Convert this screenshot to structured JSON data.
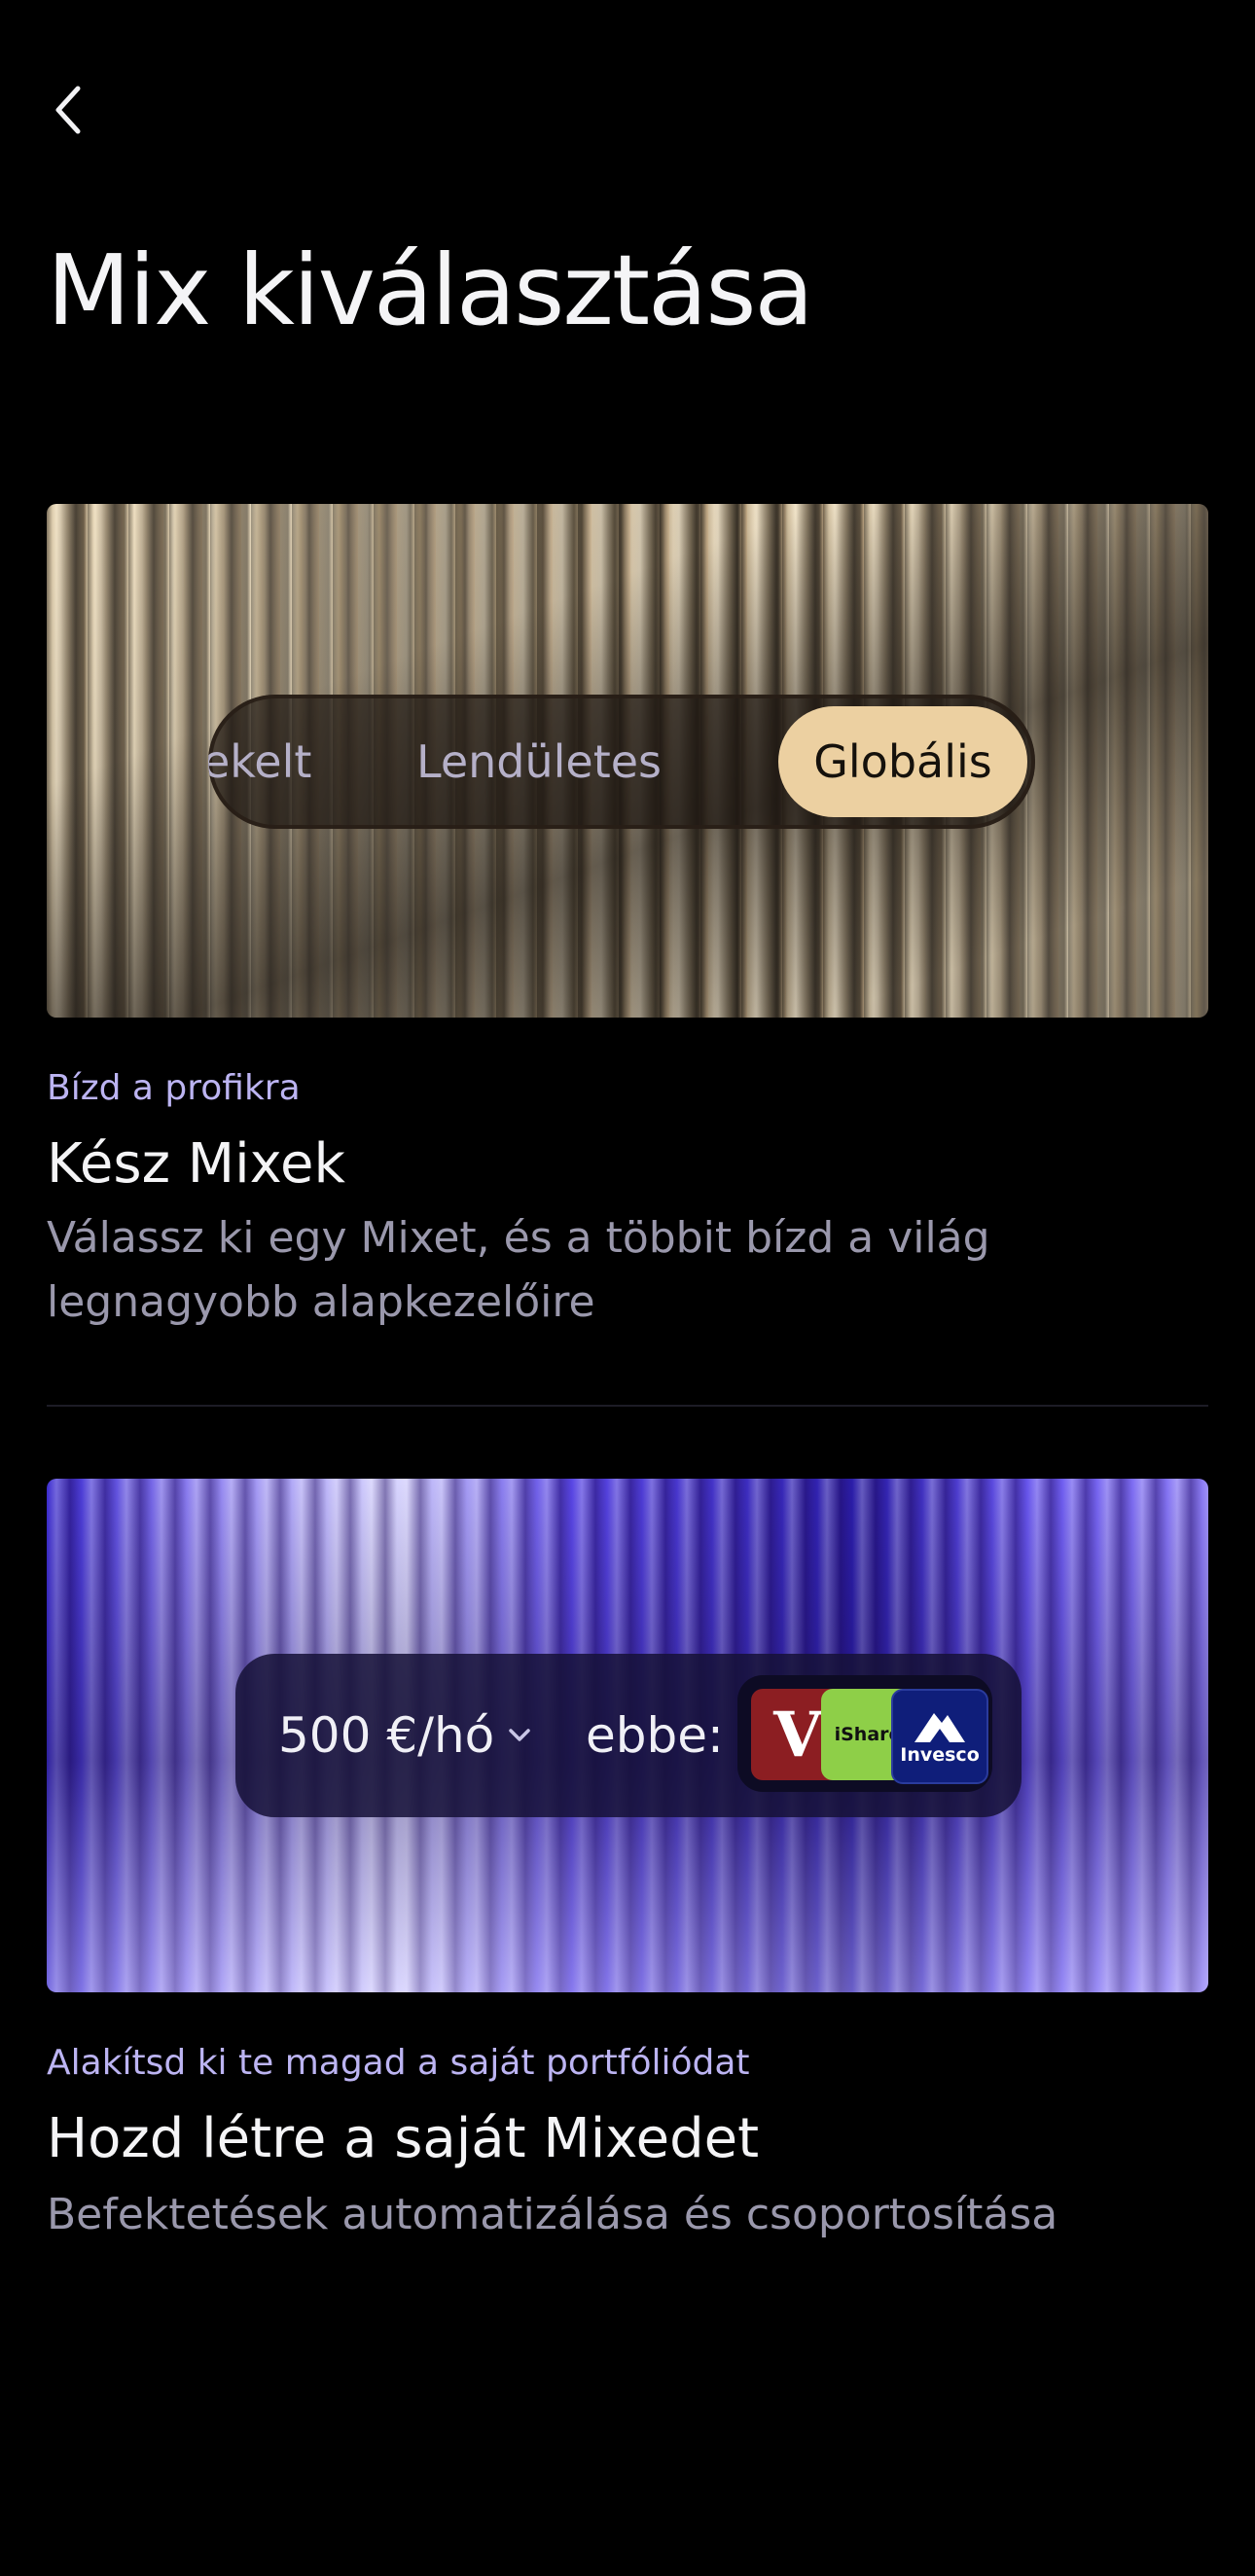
{
  "header": {
    "back_label": "Back",
    "title": "Mix kiválasztása"
  },
  "ready_mix": {
    "segments": [
      "ekelt",
      "Lendületes",
      "Globális"
    ],
    "active_segment": "Globális",
    "eyebrow": "Bízd a profikra",
    "heading": "Kész Mixek",
    "description": "Válassz ki egy Mixet, és a többit bízd a világ legnagyobb alapkezelőire"
  },
  "custom_mix": {
    "amount": "500 €/hó",
    "into_label": "ebbe:",
    "logos": [
      {
        "name": "vanguard-logo",
        "text": "V"
      },
      {
        "name": "ishares-logo",
        "text": "iShare"
      },
      {
        "name": "invesco-logo",
        "text": "Invesco"
      }
    ],
    "eyebrow": "Alakítsd ki te magad a saját portfóliódat",
    "heading": "Hozd létre a saját Mixedet",
    "description": "Befektetések automatizálása és csoportosítása"
  },
  "colors": {
    "background": "#000000",
    "accent_gold": "#ECD0A1",
    "eyebrow_lavender": "#BCB4F2",
    "muted_text": "#9A98AC"
  }
}
